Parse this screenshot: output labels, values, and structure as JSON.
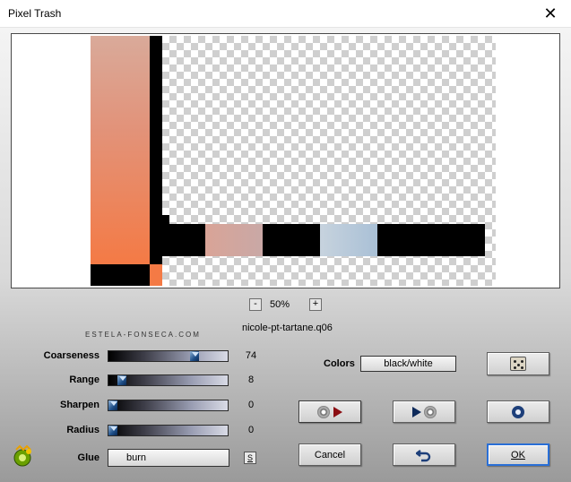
{
  "window": {
    "title": "Pixel Trash",
    "close_glyph": "✕"
  },
  "preview": {
    "zoom_out_label": "-",
    "zoom_level": "50%",
    "zoom_in_label": "+"
  },
  "brand": "ESTELA-FONSECA.COM",
  "filename": "nicole-pt-tartane.q06",
  "sliders": [
    {
      "label": "Coarseness",
      "value": "74",
      "level": 0.74
    },
    {
      "label": "Range",
      "value": "8",
      "level": 0.08
    },
    {
      "label": "Sharpen",
      "value": "0",
      "level": 0
    },
    {
      "label": "Radius",
      "value": "0",
      "level": 0
    }
  ],
  "glue": {
    "label": "Glue",
    "value": "burn",
    "s_button": "S"
  },
  "colors": {
    "label": "Colors",
    "value": "black/white"
  },
  "buttons": {
    "cancel": "Cancel",
    "ok": "OK"
  },
  "icons": {
    "random": "dice-icon",
    "load": "disc-play-icon",
    "save": "play-disc-icon",
    "reset": "ring-icon",
    "undo": "undo-arrow-icon",
    "logo": "gear-logo-icon"
  },
  "accent_colors": {
    "ok_border": "#2a6fd6",
    "thumb": "#1f4f88"
  }
}
